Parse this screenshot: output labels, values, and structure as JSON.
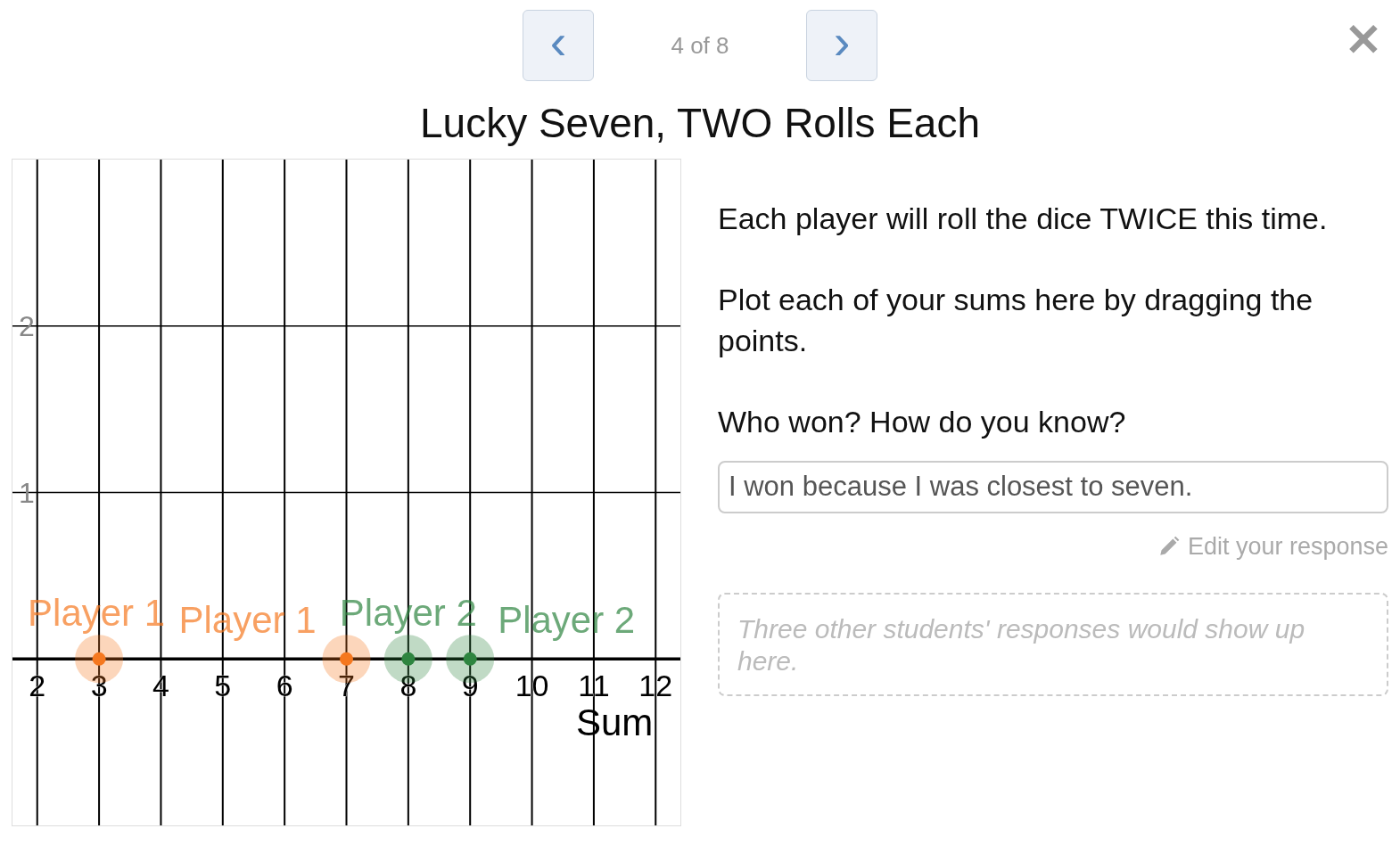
{
  "nav": {
    "previous": "‹",
    "position": "4 of 8",
    "next": "›",
    "close": "✕"
  },
  "title": "Lucky Seven, TWO Rolls Each",
  "graph": {
    "chart_data": {
      "type": "scatter",
      "grid": true,
      "xlabel": "Sum",
      "xlim": [
        1.6,
        12.4
      ],
      "ylim": [
        -1,
        3
      ],
      "xticks": [
        2,
        3,
        4,
        5,
        6,
        7,
        8,
        9,
        10,
        11,
        12
      ],
      "yticks": [
        1,
        2
      ],
      "x": [
        3,
        7,
        8,
        9
      ],
      "series": [
        {
          "color": "#f5781f",
          "values": [
            0,
            0,
            null,
            null
          ]
        },
        {
          "color": "#2e8540",
          "values": [
            null,
            null,
            0,
            0
          ]
        }
      ],
      "annotations": [
        "Player 1",
        "Player 1",
        "Player 2",
        "Player 2"
      ]
    }
  },
  "paragraphs": [
    "Each player will roll the dice TWICE this time.",
    "Plot each of your sums here by dragging the points.",
    "Who won?  How do you know?"
  ],
  "answer": {
    "value": "I won because I was closest to seven.",
    "edit_link": "Edit your response"
  },
  "others": {
    "message": "Three other students' responses would show up here."
  }
}
